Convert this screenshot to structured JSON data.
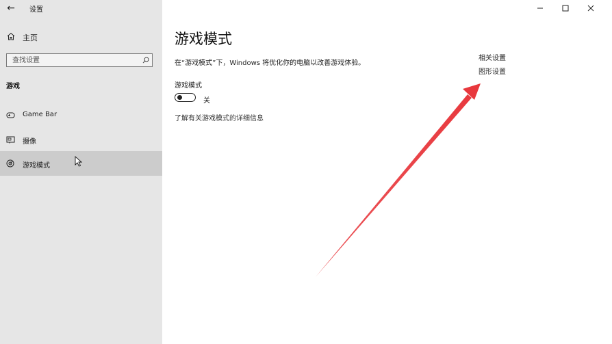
{
  "window": {
    "title": "设置",
    "back_icon": "back-arrow-icon",
    "controls": [
      "minimize-icon",
      "maximize-icon",
      "close-icon"
    ]
  },
  "sidebar": {
    "home_label": "主页",
    "search_placeholder": "查找设置",
    "section_title": "游戏",
    "items": [
      {
        "label": "Game Bar",
        "icon": "game-bar-icon",
        "selected": false
      },
      {
        "label": "摄像",
        "icon": "capture-icon",
        "selected": false
      },
      {
        "label": "游戏模式",
        "icon": "game-mode-icon",
        "selected": true
      }
    ]
  },
  "main": {
    "title": "游戏模式",
    "description": "在“游戏模式”下，Windows 将优化你的电脑以改善游戏体验。",
    "toggle_label": "游戏模式",
    "toggle_state": "关",
    "toggle_on": false,
    "learn_more": "了解有关游戏模式的详细信息"
  },
  "related": {
    "title": "相关设置",
    "link": "图形设置"
  },
  "annotation": {
    "color": "#e8383d"
  }
}
